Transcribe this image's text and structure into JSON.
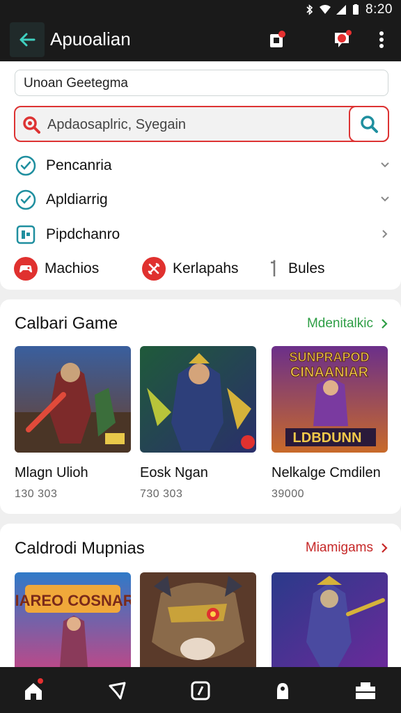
{
  "status_bar": {
    "time": "8:20",
    "icons": [
      "bluetooth-icon",
      "wifi-icon",
      "signal-icon",
      "battery-icon"
    ]
  },
  "app_bar": {
    "title": "Apuoalian",
    "actions": [
      "copy-icon",
      "chat-icon",
      "more-vert-icon"
    ]
  },
  "filters": {
    "top_input_value": "Unoan Geetegma",
    "search_value": "Apdaosaplric, Syegain",
    "options": [
      {
        "label": "Pencanria",
        "icon": "check-circle-icon"
      },
      {
        "label": "Apldiarrig",
        "icon": "check-circle-icon"
      },
      {
        "label": "Pipdchanro",
        "icon": "grid-icon"
      }
    ],
    "tags": [
      {
        "label": "Machios",
        "icon": "gamepad-icon"
      },
      {
        "label": "Kerlapahs",
        "icon": "sword-icon"
      },
      {
        "label": "Bules",
        "icon": "info-icon"
      }
    ]
  },
  "section1": {
    "title": "Calbari Game",
    "link": "Mdenitalkic",
    "games": [
      {
        "name": "Mlagn Ulioh",
        "count": "130 303"
      },
      {
        "name": "Eosk Ngan",
        "count": "730 303"
      },
      {
        "name": "Nelkalge Cmdilen",
        "count": "39000"
      }
    ]
  },
  "section2": {
    "title": "Caldrodi Mupnias",
    "link": "Miamigams",
    "poster_text": "IIAREO COSNAR"
  },
  "poster1": {
    "line1": "SUNPRAPOD",
    "line2": "CINAANIAR",
    "line3": "LDBDUNN"
  },
  "colors": {
    "accent_red": "#d33333",
    "link_green": "#2e9e45",
    "link_red": "#c62828",
    "bar_dark": "#1a1a1a",
    "teal": "#1f8f8f"
  },
  "bottom_nav": [
    "home-icon",
    "location-icon",
    "store-icon",
    "profile-icon",
    "cart-icon"
  ]
}
